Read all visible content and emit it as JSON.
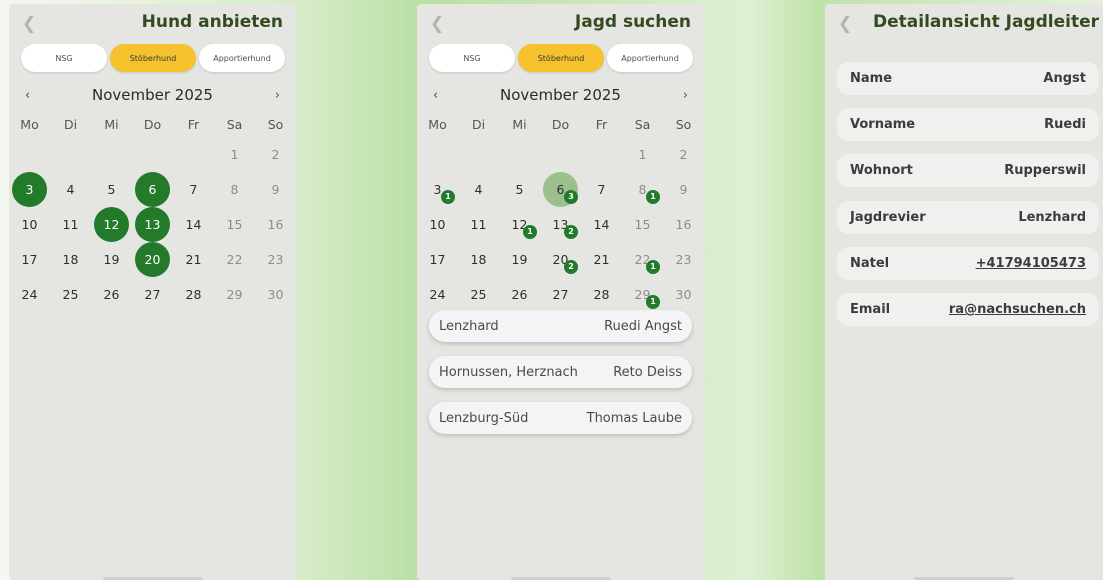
{
  "panel1": {
    "back_icon": "chevron-left",
    "title": "Hund anbieten",
    "segments": [
      "NSG",
      "Stöberhund",
      "Apportierhund"
    ],
    "active_segment": "Stöberhund",
    "month_label": "November 2025",
    "prev": "‹",
    "next": "›",
    "weekdays": [
      "Mo",
      "Di",
      "Mi",
      "Do",
      "Fr",
      "Sa",
      "So"
    ],
    "weeks": [
      [
        "",
        "",
        "",
        "",
        "",
        "1",
        "2"
      ],
      [
        "3",
        "4",
        "5",
        "6",
        "7",
        "8",
        "9"
      ],
      [
        "10",
        "11",
        "12",
        "13",
        "14",
        "15",
        "16"
      ],
      [
        "17",
        "18",
        "19",
        "20",
        "21",
        "22",
        "23"
      ],
      [
        "24",
        "25",
        "26",
        "27",
        "28",
        "29",
        "30"
      ]
    ],
    "selected_days": [
      "3",
      "6",
      "12",
      "13",
      "20"
    ],
    "selected_color": "#237a2a"
  },
  "panel2": {
    "back_icon": "chevron-left",
    "title": "Jagd suchen",
    "segments": [
      "NSG",
      "Stöberhund",
      "Apportierhund"
    ],
    "active_segment": "Stöberhund",
    "month_label": "November 2025",
    "prev": "‹",
    "next": "›",
    "weekdays": [
      "Mo",
      "Di",
      "Mi",
      "Do",
      "Fr",
      "Sa",
      "So"
    ],
    "weeks": [
      [
        "",
        "",
        "",
        "",
        "",
        "1",
        "2"
      ],
      [
        "3",
        "4",
        "5",
        "6",
        "7",
        "8",
        "9"
      ],
      [
        "10",
        "11",
        "12",
        "13",
        "14",
        "15",
        "16"
      ],
      [
        "17",
        "18",
        "19",
        "20",
        "21",
        "22",
        "23"
      ],
      [
        "24",
        "25",
        "26",
        "27",
        "28",
        "29",
        "30"
      ]
    ],
    "highlighted_day": "6",
    "badges": {
      "3": "1",
      "6": "3",
      "8": "1",
      "12": "1",
      "13": "2",
      "20": "2",
      "22": "1",
      "29": "1"
    },
    "hunts": [
      {
        "place": "Lenzhard",
        "leader": "Ruedi Angst"
      },
      {
        "place": "Hornussen, Herznach",
        "leader": "Reto Deiss"
      },
      {
        "place": "Lenzburg-Süd",
        "leader": "Thomas Laube"
      }
    ]
  },
  "panel3": {
    "back_icon": "chevron-left",
    "title": "Detailansicht Jagdleiter",
    "fields": [
      {
        "label": "Name",
        "value": "Angst"
      },
      {
        "label": "Vorname",
        "value": "Ruedi"
      },
      {
        "label": "Wohnort",
        "value": "Rupperswil"
      },
      {
        "label": "Jagdrevier",
        "value": "Lenzhard"
      },
      {
        "label": "Natel",
        "value": "+41794105473",
        "link": true
      },
      {
        "label": "Email",
        "value": "ra@nachsuchen.ch",
        "link": true
      }
    ]
  },
  "colors": {
    "accent_green": "#237a2a",
    "segment_active": "#f5c12c",
    "title_green": "#344a20"
  }
}
